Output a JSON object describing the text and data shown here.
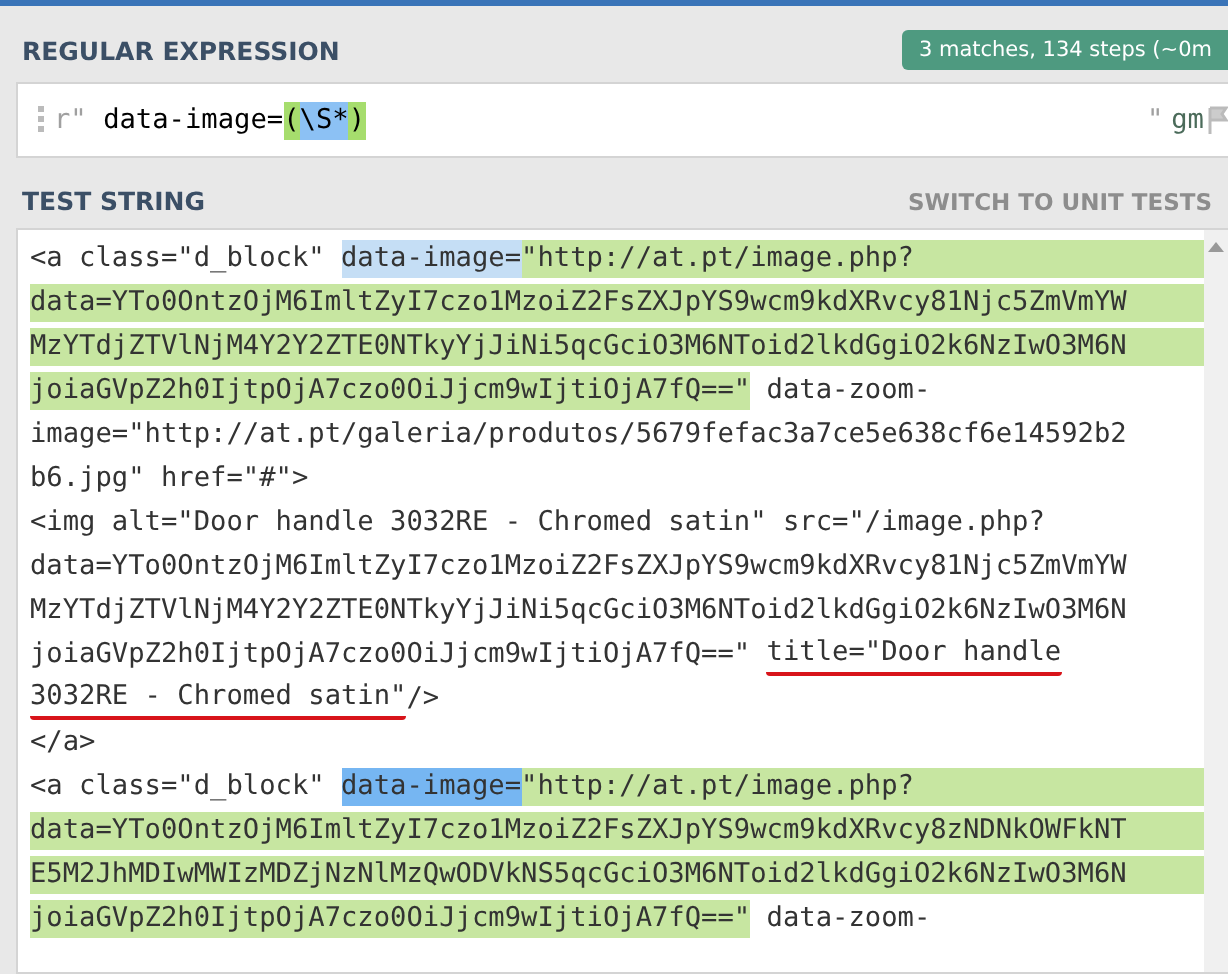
{
  "regex_section": {
    "title": "REGULAR EXPRESSION",
    "badge": "3 matches, 134 steps (~0m",
    "delimiter_open": "r\"",
    "delimiter_close": "\"",
    "flags": "gm",
    "pattern": [
      {
        "kind": "plain",
        "text": "data-image="
      },
      {
        "kind": "group",
        "text": "("
      },
      {
        "kind": "token",
        "text": "\\S*"
      },
      {
        "kind": "group",
        "text": ")"
      }
    ]
  },
  "test_section": {
    "title": "TEST STRING",
    "switch_link": "SWITCH TO UNIT TESTS",
    "lines": [
      [
        {
          "kind": "plain",
          "text": "<a class=\"d_block\" "
        },
        {
          "kind": "group",
          "text": "data-image="
        },
        {
          "kind": "match",
          "text": "\"http://at.pt/image.php?"
        }
      ],
      [
        {
          "kind": "match",
          "text": "data=YTo0OntzOjM6ImltZyI7czo1MzoiZ2FsZXJpYS9wcm9kdXRvcy81Njc5ZmVmYW"
        }
      ],
      [
        {
          "kind": "match",
          "text": "MzYTdjZTVlNjM4Y2Y2ZTE0NTkyYjJiNi5qcGciO3M6NToid2lkdGgiO2k6NzIwO3M6N"
        }
      ],
      [
        {
          "kind": "match",
          "text": "joiaGVpZ2h0IjtpOjA7czo0OiJjcm9wIjtiOjA7fQ==\""
        },
        {
          "kind": "plain",
          "text": " data-zoom-"
        }
      ],
      [
        {
          "kind": "plain",
          "text": "image=\"http://at.pt/galeria/produtos/5679fefac3a7ce5e638cf6e14592b2"
        }
      ],
      [
        {
          "kind": "plain",
          "text": "b6.jpg\" href=\"#\">"
        }
      ],
      [
        {
          "kind": "plain",
          "text": "<img alt=\"Door handle 3032RE - Chromed satin\" src=\"/image.php?"
        }
      ],
      [
        {
          "kind": "plain",
          "text": "data=YTo0OntzOjM6ImltZyI7czo1MzoiZ2FsZXJpYS9wcm9kdXRvcy81Njc5ZmVmYW"
        }
      ],
      [
        {
          "kind": "plain",
          "text": "MzYTdjZTVlNjM4Y2Y2ZTE0NTkyYjJiNi5qcGciO3M6NToid2lkdGgiO2k6NzIwO3M6N"
        }
      ],
      [
        {
          "kind": "plain",
          "text": "joiaGVpZ2h0IjtpOjA7czo0OiJjcm9wIjtiOjA7fQ==\" "
        },
        {
          "kind": "plain",
          "text": "title=\"Door handle",
          "underlined": true
        }
      ],
      [
        {
          "kind": "plain",
          "text": "3032RE - Chromed satin\"",
          "underlined": true
        },
        {
          "kind": "plain",
          "text": "/>"
        }
      ],
      [
        {
          "kind": "plain",
          "text": "</a>"
        }
      ],
      [
        {
          "kind": "plain",
          "text": "<a class=\"d_block\" "
        },
        {
          "kind": "group_active",
          "text": "data-image="
        },
        {
          "kind": "match",
          "text": "\"http://at.pt/image.php?"
        }
      ],
      [
        {
          "kind": "match",
          "text": "data=YTo0OntzOjM6ImltZyI7czo1MzoiZ2FsZXJpYS9wcm9kdXRvcy8zNDNkOWFkNT"
        }
      ],
      [
        {
          "kind": "match",
          "text": "E5M2JhMDIwMWIzMDZjNzNlMzQwODVkNS5qcGciO3M6NToid2lkdGgiO2k6NzIwO3M6N"
        }
      ],
      [
        {
          "kind": "match",
          "text": "joiaGVpZ2h0IjtpOjA7czo0OiJjcm9wIjtiOjA7fQ==\""
        },
        {
          "kind": "plain",
          "text": " data-zoom-"
        }
      ]
    ]
  }
}
